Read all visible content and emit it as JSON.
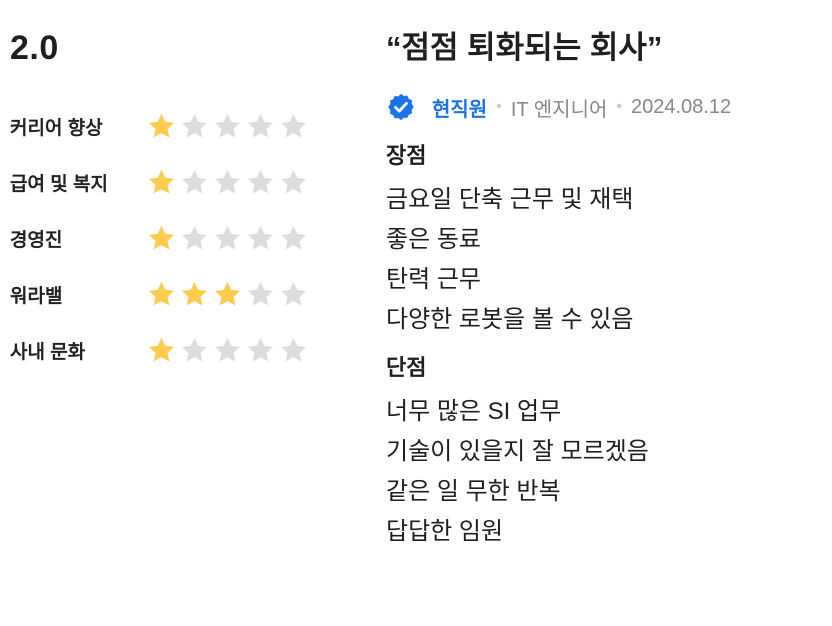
{
  "summary": {
    "score": "2.0",
    "ratings": [
      {
        "label": "커리어 향상",
        "stars": 1
      },
      {
        "label": "급여 및 복지",
        "stars": 1
      },
      {
        "label": "경영진",
        "stars": 1
      },
      {
        "label": "워라밸",
        "stars": 3
      },
      {
        "label": "사내 문화",
        "stars": 1
      }
    ],
    "max_stars": 5,
    "star_color_filled": "#FFCC4D",
    "star_color_empty": "#DDDDDD"
  },
  "review": {
    "title": "“점점 퇴화되는 회사”",
    "status": "현직원",
    "job": "IT 엔지니어",
    "date": "2024.08.12",
    "pros_title": "장점",
    "pros": [
      "금요일 단축 근무 및 재택",
      "좋은 동료",
      "탄력 근무",
      "다양한 로봇을 볼 수 있음"
    ],
    "cons_title": "단점",
    "cons": [
      "너무 많은 SI 업무",
      "기술이 있을지 잘 모르겠음",
      "같은 일 무한 반복",
      "답답한 임원"
    ],
    "accent_color": "#1A73E8"
  }
}
